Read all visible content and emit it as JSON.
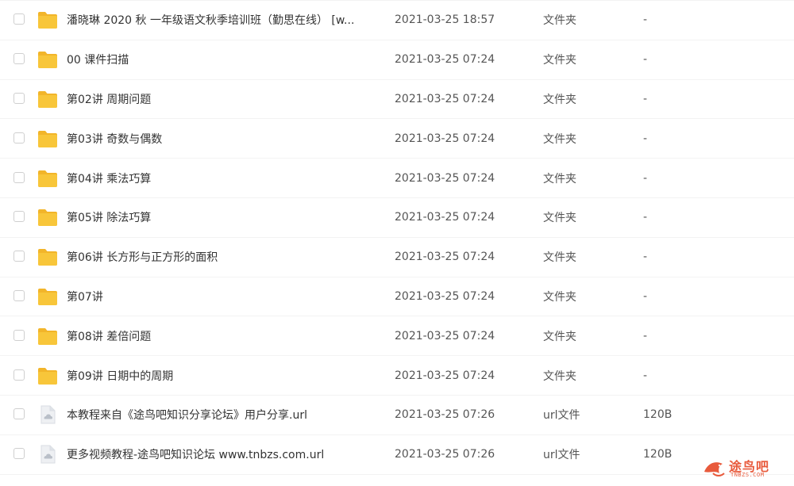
{
  "files": [
    {
      "name": "潘晓琳 2020 秋 一年级语文秋季培训班（勤思在线）  [w...",
      "date": "2021-03-25 18:57",
      "type": "文件夹",
      "size": "-",
      "icon": "folder-icon"
    },
    {
      "name": "00 课件扫描",
      "date": "2021-03-25 07:24",
      "type": "文件夹",
      "size": "-",
      "icon": "folder-icon"
    },
    {
      "name": "第02讲 周期问题",
      "date": "2021-03-25 07:24",
      "type": "文件夹",
      "size": "-",
      "icon": "folder-icon"
    },
    {
      "name": "第03讲 奇数与偶数",
      "date": "2021-03-25 07:24",
      "type": "文件夹",
      "size": "-",
      "icon": "folder-icon"
    },
    {
      "name": "第04讲 乘法巧算",
      "date": "2021-03-25 07:24",
      "type": "文件夹",
      "size": "-",
      "icon": "folder-icon"
    },
    {
      "name": "第05讲 除法巧算",
      "date": "2021-03-25 07:24",
      "type": "文件夹",
      "size": "-",
      "icon": "folder-icon"
    },
    {
      "name": "第06讲 长方形与正方形的面积",
      "date": "2021-03-25 07:24",
      "type": "文件夹",
      "size": "-",
      "icon": "folder-icon"
    },
    {
      "name": "第07讲",
      "date": "2021-03-25 07:24",
      "type": "文件夹",
      "size": "-",
      "icon": "folder-icon"
    },
    {
      "name": "第08讲 差倍问题",
      "date": "2021-03-25 07:24",
      "type": "文件夹",
      "size": "-",
      "icon": "folder-icon"
    },
    {
      "name": "第09讲 日期中的周期",
      "date": "2021-03-25 07:24",
      "type": "文件夹",
      "size": "-",
      "icon": "folder-icon"
    },
    {
      "name": "本教程来自《途鸟吧知识分享论坛》用户分享.url",
      "date": "2021-03-25 07:26",
      "type": "url文件",
      "size": "120B",
      "icon": "url-file-icon"
    },
    {
      "name": "更多视频教程-途鸟吧知识论坛 www.tnbzs.com.url",
      "date": "2021-03-25 07:26",
      "type": "url文件",
      "size": "120B",
      "icon": "url-file-icon"
    }
  ],
  "watermark": {
    "text": "途鸟吧",
    "subtext": "TNBZS.COM"
  },
  "colors": {
    "folder": "#f8c63a",
    "folder_tab": "#f2b52a",
    "url_file": "#d9dde3",
    "watermark": "#e85a3c"
  }
}
